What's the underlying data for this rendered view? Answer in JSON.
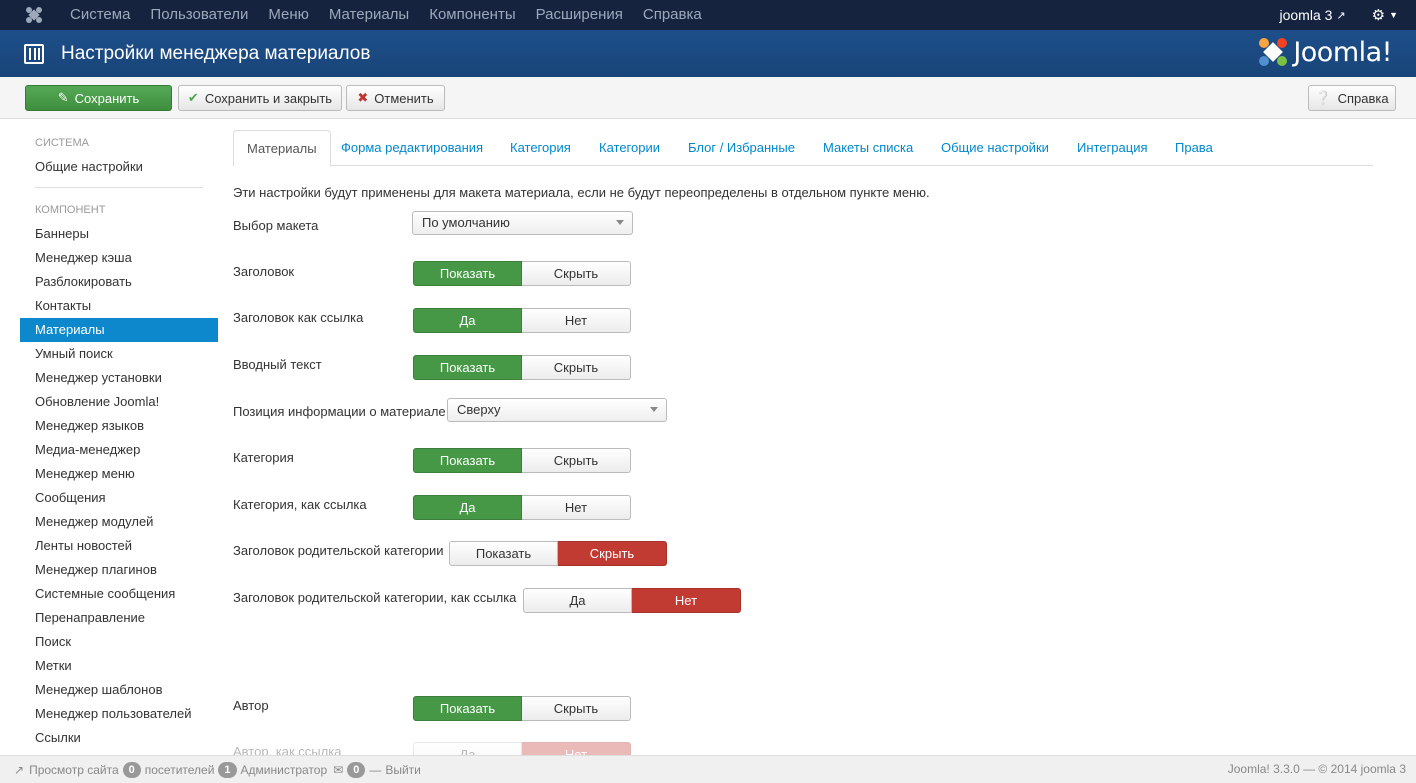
{
  "topnav": {
    "menu": [
      "Система",
      "Пользователи",
      "Меню",
      "Материалы",
      "Компоненты",
      "Расширения",
      "Справка"
    ],
    "user": "joomla 3"
  },
  "header": {
    "title": "Настройки менеджера материалов",
    "brand": "Joomla!"
  },
  "toolbar": {
    "save": "Сохранить",
    "save_close": "Сохранить и закрыть",
    "cancel": "Отменить",
    "help": "Справка"
  },
  "sidebar": {
    "system_header": "СИСТЕМА",
    "system_item": "Общие настройки",
    "component_header": "КОМПОНЕНТ",
    "items": [
      "Баннеры",
      "Менеджер кэша",
      "Разблокировать",
      "Контакты",
      "Материалы",
      "Умный поиск",
      "Менеджер установки",
      "Обновление Joomla!",
      "Менеджер языков",
      "Медиа-менеджер",
      "Менеджер меню",
      "Сообщения",
      "Менеджер модулей",
      "Ленты новостей",
      "Менеджер плагинов",
      "Системные сообщения",
      "Перенаправление",
      "Поиск",
      "Метки",
      "Менеджер шаблонов",
      "Менеджер пользователей",
      "Ссылки"
    ],
    "active_index": 4
  },
  "tabs": [
    "Материалы",
    "Форма редактирования",
    "Категория",
    "Категории",
    "Блог / Избранные",
    "Макеты списка",
    "Общие настройки",
    "Интеграция",
    "Права"
  ],
  "form": {
    "description": "Эти настройки будут применены для макета материала, если не будут переопределены в отдельном пункте меню.",
    "layout_label": "Выбор макета",
    "layout_value": "По умолчанию",
    "title_label": "Заголовок",
    "title_link_label": "Заголовок как ссылка",
    "intro_label": "Вводный текст",
    "info_pos_label": "Позиция информации о материале",
    "info_pos_value": "Сверху",
    "category_label": "Категория",
    "category_link_label": "Категория, как ссылка",
    "parent_label": "Заголовок родительской категории",
    "parent_link_label": "Заголовок родительской категории, как ссылка",
    "author_label": "Автор",
    "author_link_label": "Автор, как ссылка",
    "show": "Показать",
    "hide": "Скрыть",
    "yes": "Да",
    "no": "Нет"
  },
  "footer": {
    "view_site": "Просмотр сайта",
    "visitors_count": "0",
    "visitors": "посетителей",
    "admins_count": "1",
    "admins": "Администратор",
    "msg_count": "0",
    "logout": "Выйти",
    "version": "Joomla! 3.3.0 — © 2014 joomla 3"
  },
  "colors": {
    "nav": "#15233f",
    "header": "#1a4a83",
    "green": "#469846",
    "red": "#c23b33",
    "active": "#0e88cc"
  }
}
